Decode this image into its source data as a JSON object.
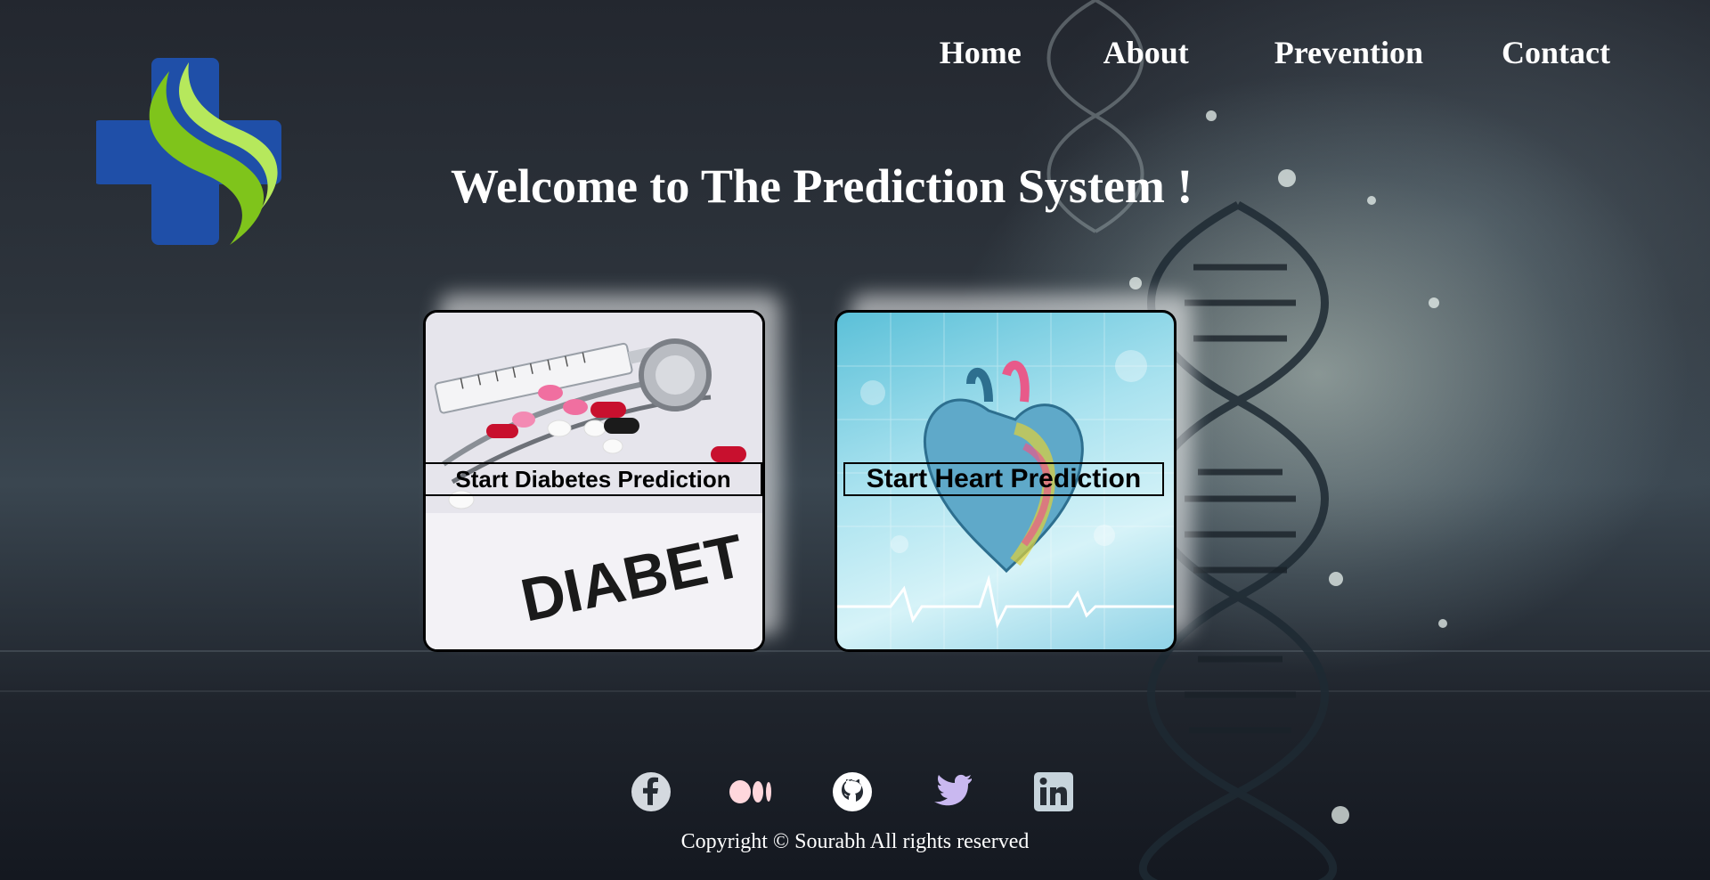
{
  "nav": {
    "home": "Home",
    "about": "About",
    "prevention": "Prevention",
    "contact": "Contact"
  },
  "hero": {
    "title": "Welcome to The Prediction System !"
  },
  "cards": {
    "diabetes": {
      "button": "Start Diabetes Prediction",
      "image_text": "DIABET"
    },
    "heart": {
      "button": "Start Heart Prediction"
    }
  },
  "socials": [
    "facebook-icon",
    "medium-icon",
    "github-icon",
    "twitter-icon",
    "linkedin-icon"
  ],
  "footer": {
    "copyright": "Copyright © Sourabh All rights reserved"
  },
  "colors": {
    "logo_blue": "#1f4fa8",
    "logo_green": "#8cd11f",
    "nav_text": "#ffffff",
    "twitter": "#c9b8f0",
    "medium": "#ffd7dc"
  }
}
